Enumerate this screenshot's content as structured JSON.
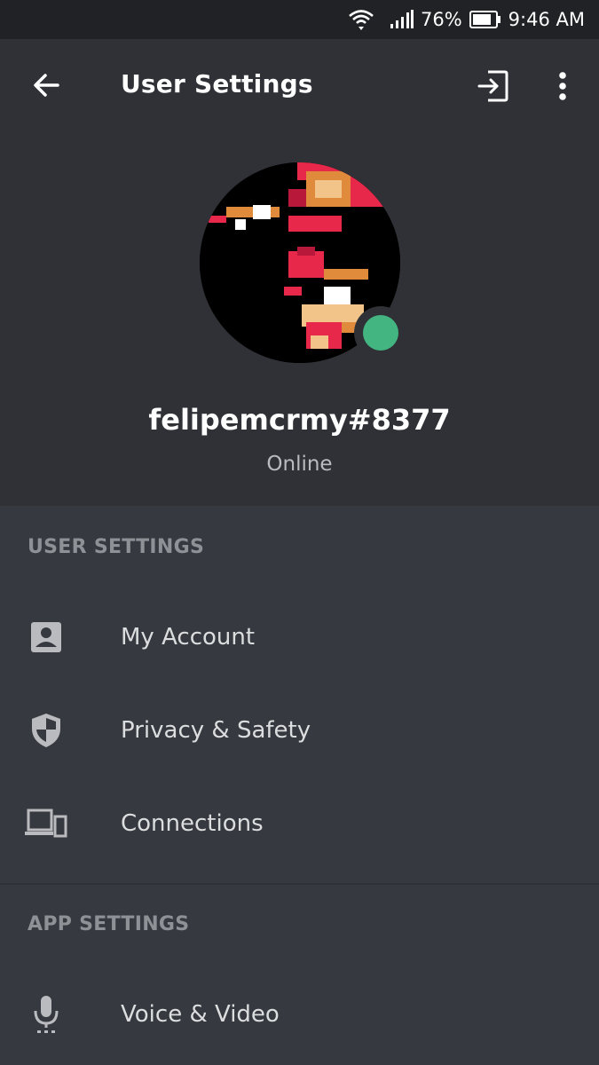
{
  "status_bar": {
    "battery": "76%",
    "time": "9:46 AM"
  },
  "toolbar": {
    "title": "User Settings",
    "back_icon": "arrow-left-icon",
    "logout_icon": "logout-icon",
    "more_icon": "more-vertical-icon"
  },
  "profile": {
    "username": "felipemcrmy#8377",
    "status": "Online",
    "status_color": "#43b581"
  },
  "sections": {
    "user_settings": {
      "header": "USER SETTINGS",
      "items": [
        {
          "label": "My Account",
          "icon": "account-box-icon"
        },
        {
          "label": "Privacy & Safety",
          "icon": "shield-icon"
        },
        {
          "label": "Connections",
          "icon": "devices-icon"
        }
      ]
    },
    "app_settings": {
      "header": "APP SETTINGS",
      "items": [
        {
          "label": "Voice & Video",
          "icon": "microphone-icon"
        }
      ]
    }
  },
  "colors": {
    "background": "#36393f",
    "header": "#2f3136",
    "statusbar": "#202225",
    "section_text": "#8e9297",
    "item_text": "#dcddde",
    "online": "#43b581"
  }
}
